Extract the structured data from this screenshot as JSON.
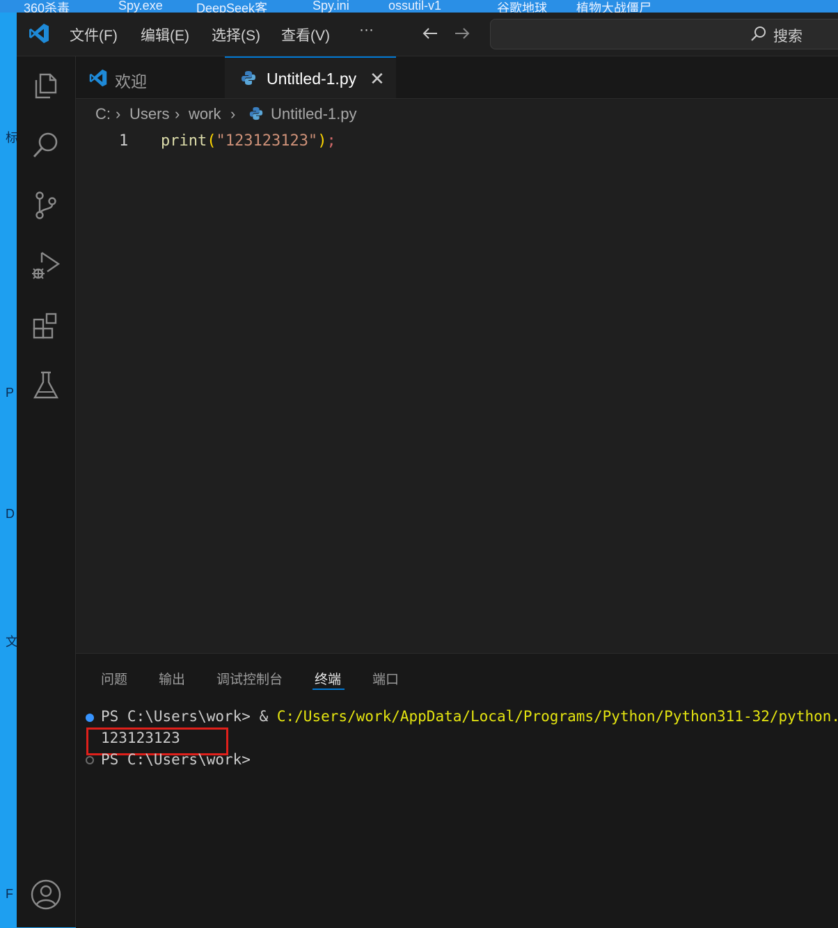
{
  "desktop": {
    "top_items": [
      "360杀毒",
      "Spy.exe",
      "DeepSeek客",
      "Spy.ini",
      "ossutil-v1",
      "谷歌地球",
      "植物大战僵尸"
    ],
    "left_items": [
      "标",
      "P",
      "D",
      "文",
      "F"
    ]
  },
  "titlebar": {
    "menu": [
      "文件(F)",
      "编辑(E)",
      "选择(S)",
      "查看(V)",
      "···"
    ],
    "search_placeholder": "搜索"
  },
  "activity_bar": {
    "icons": [
      "explorer-icon",
      "search-icon",
      "source-control-icon",
      "run-debug-icon",
      "extensions-icon",
      "testing-icon",
      "account-icon"
    ]
  },
  "tabs": [
    {
      "label": "欢迎",
      "icon": "vscode-logo-icon"
    },
    {
      "label": "Untitled-1.py",
      "icon": "python-icon",
      "close": "✕"
    }
  ],
  "breadcrumb": [
    "C:",
    "Users",
    "work",
    "Untitled-1.py"
  ],
  "editor": {
    "line_number": "1",
    "code": {
      "fn": "print",
      "open": "(",
      "str": "\"123123123\"",
      "close": ")",
      "semi": ";"
    }
  },
  "panel": {
    "tabs": [
      "问题",
      "输出",
      "调试控制台",
      "终端",
      "端口"
    ],
    "active_tab": "终端",
    "terminal": {
      "line1_prompt": "PS C:\\Users\\work> & ",
      "line1_path": "C:/Users/work/AppData/Local/Programs/Python/Python311-32/python.",
      "output": "123123123",
      "line3_prompt": "PS C:\\Users\\work>"
    }
  },
  "colors": {
    "accent": "#0078d4",
    "highlight_box": "#e0201b",
    "desktop_bg": "#1e9ff0"
  }
}
